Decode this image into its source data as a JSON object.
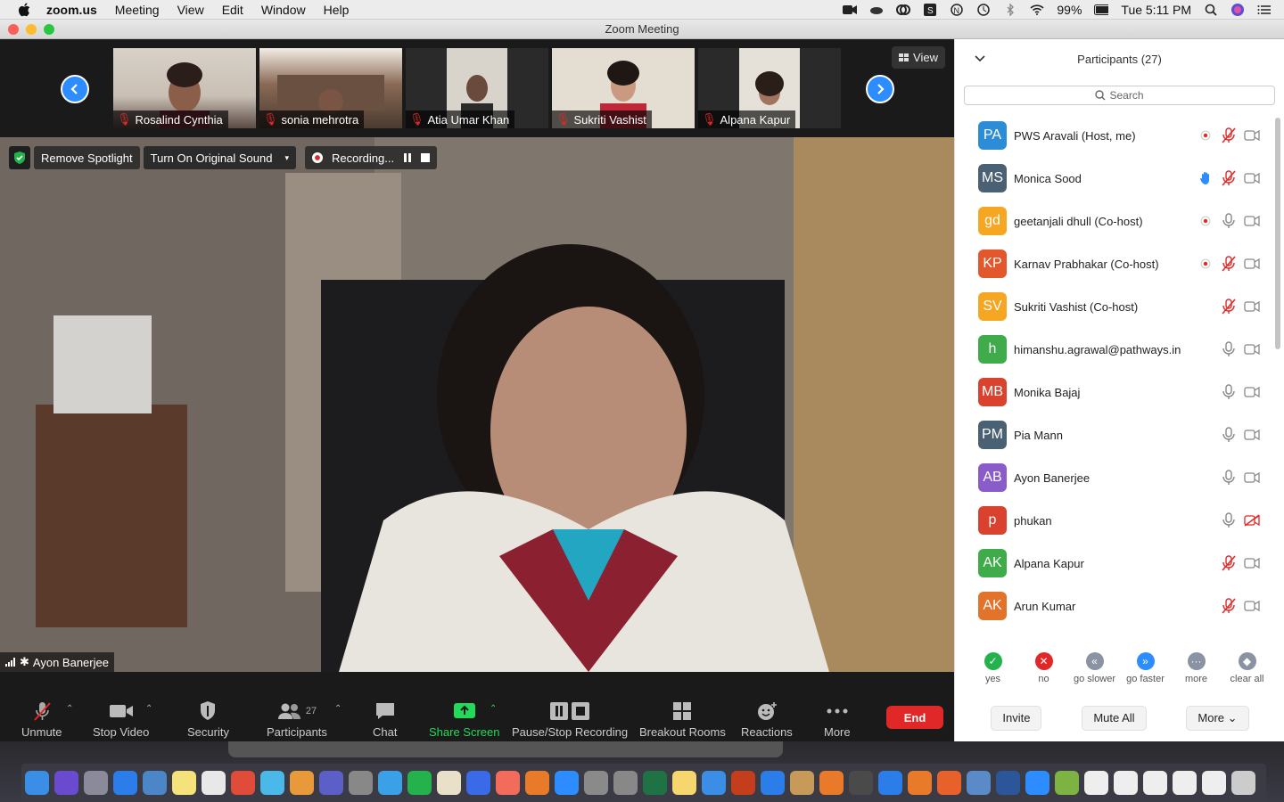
{
  "menubar": {
    "app_name": "zoom.us",
    "items": [
      "Meeting",
      "View",
      "Edit",
      "Window",
      "Help"
    ],
    "battery": "99%",
    "clock": "Tue 5:11 PM"
  },
  "window": {
    "title": "Zoom Meeting"
  },
  "thumbnails": [
    {
      "name": "Rosalind Cynthia"
    },
    {
      "name": "sonia mehrotra"
    },
    {
      "name": "Atia Umar Khan"
    },
    {
      "name": "Sukriti Vashist"
    },
    {
      "name": "Alpana Kapur"
    }
  ],
  "view_button": "View",
  "stage": {
    "remove_spotlight": "Remove Spotlight",
    "original_sound": "Turn On Original Sound",
    "recording": "Recording...",
    "speaker": "Ayon Banerjee"
  },
  "toolbar": {
    "unmute": "Unmute",
    "stop_video": "Stop Video",
    "security": "Security",
    "participants": "Participants",
    "participants_count": "27",
    "chat": "Chat",
    "share_screen": "Share Screen",
    "pause_recording": "Pause/Stop Recording",
    "breakout": "Breakout Rooms",
    "reactions": "Reactions",
    "more": "More",
    "end": "End"
  },
  "panel": {
    "title": "Participants (27)",
    "search_placeholder": "Search",
    "participants": [
      {
        "initials": "PA",
        "name": "PWS Aravali (Host, me)",
        "color": "#2d8cd6",
        "rec": true,
        "hand": false,
        "mic": "muted",
        "video": "on"
      },
      {
        "initials": "MS",
        "name": "Monica Sood",
        "color": "#4a6073",
        "rec": false,
        "hand": true,
        "mic": "muted",
        "video": "on"
      },
      {
        "initials": "gd",
        "name": "geetanjali dhull (Co-host)",
        "color": "#f5a623",
        "rec": true,
        "hand": false,
        "mic": "on",
        "video": "on"
      },
      {
        "initials": "KP",
        "name": "Karnav Prabhakar (Co-host)",
        "color": "#e2572b",
        "rec": true,
        "hand": false,
        "mic": "muted",
        "video": "on"
      },
      {
        "initials": "SV",
        "name": "Sukriti Vashist (Co-host)",
        "color": "#f5a623",
        "rec": false,
        "hand": false,
        "mic": "muted",
        "video": "on"
      },
      {
        "initials": "h",
        "name": "himanshu.agrawal@pathways.in",
        "color": "#3fab4b",
        "rec": false,
        "hand": false,
        "mic": "on",
        "video": "on"
      },
      {
        "initials": "MB",
        "name": "Monika Bajaj",
        "color": "#d9422f",
        "rec": false,
        "hand": false,
        "mic": "on",
        "video": "on"
      },
      {
        "initials": "PM",
        "name": "Pia Mann",
        "color": "#4a6073",
        "rec": false,
        "hand": false,
        "mic": "on",
        "video": "on"
      },
      {
        "initials": "AB",
        "name": "Ayon Banerjee",
        "color": "#8a5cc9",
        "rec": false,
        "hand": false,
        "mic": "on",
        "video": "on"
      },
      {
        "initials": "p",
        "name": "phukan",
        "color": "#d9422f",
        "rec": false,
        "hand": false,
        "mic": "on",
        "video": "off"
      },
      {
        "initials": "AK",
        "name": "Alpana Kapur",
        "color": "#3fab4b",
        "rec": false,
        "hand": false,
        "mic": "muted",
        "video": "on"
      },
      {
        "initials": "AK",
        "name": "Arun Kumar",
        "color": "#e2732b",
        "rec": false,
        "hand": false,
        "mic": "muted",
        "video": "on"
      }
    ],
    "feedback": [
      {
        "label": "yes",
        "color": "#23b24b",
        "glyph": "✓"
      },
      {
        "label": "no",
        "color": "#e02828",
        "glyph": "✕"
      },
      {
        "label": "go slower",
        "color": "#8a93a3",
        "glyph": "«"
      },
      {
        "label": "go faster",
        "color": "#2d8cff",
        "glyph": "»"
      },
      {
        "label": "more",
        "color": "#8a93a3",
        "glyph": "···"
      },
      {
        "label": "clear all",
        "color": "#8a93a3",
        "glyph": "◆"
      }
    ],
    "invite": "Invite",
    "mute_all": "Mute All",
    "more": "More"
  }
}
